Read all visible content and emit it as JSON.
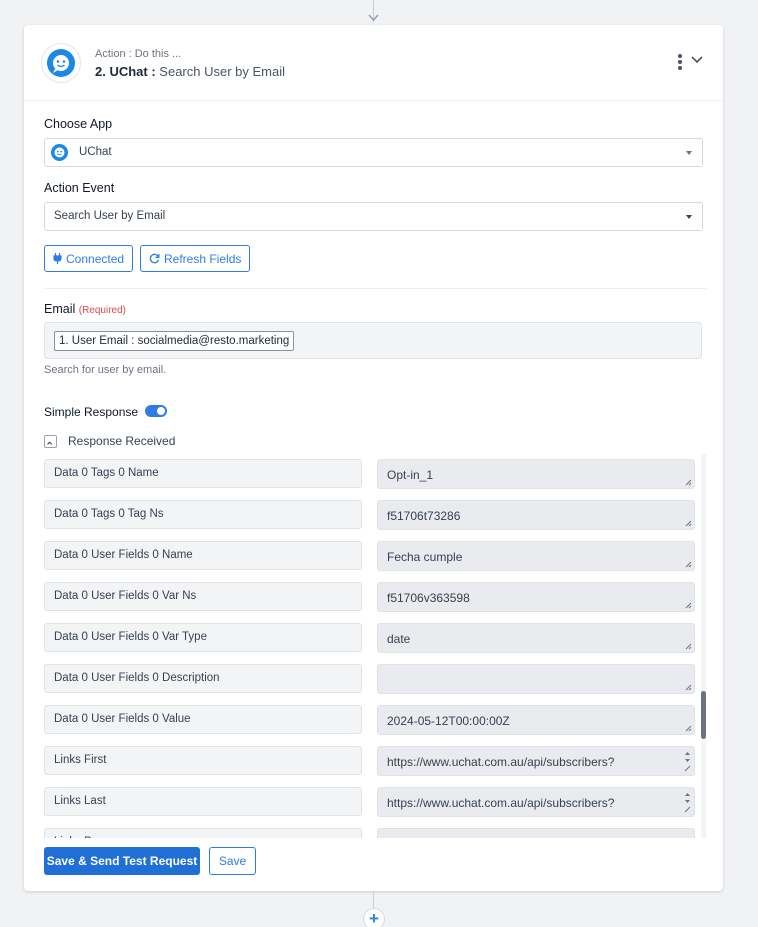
{
  "step": {
    "subtitle": "Action : Do this ...",
    "number_app": "2. UChat :",
    "event": "Search User by Email"
  },
  "form": {
    "choose_app_label": "Choose App",
    "app_value": "UChat",
    "action_event_label": "Action Event",
    "action_event_value": "Search User by Email",
    "connected_button": "Connected",
    "refresh_button": "Refresh Fields",
    "email_label": "Email",
    "required_tag": "(Required)",
    "email_chip": "1. User Email : socialmedia@resto.marketing",
    "email_hint": "Search for user by email.",
    "simple_response_label": "Simple Response",
    "simple_response_on": true,
    "response_received_label": "Response Received"
  },
  "response_rows": [
    {
      "key": "Data 0 Tags 0 Name",
      "value": "Opt-in_1"
    },
    {
      "key": "Data 0 Tags 0 Tag Ns",
      "value": "f51706t73286"
    },
    {
      "key": "Data 0 User Fields 0 Name",
      "value": "Fecha cumple"
    },
    {
      "key": "Data 0 User Fields 0 Var Ns",
      "value": "f51706v363598"
    },
    {
      "key": "Data 0 User Fields 0 Var Type",
      "value": "date"
    },
    {
      "key": "Data 0 User Fields 0 Description",
      "value": ""
    },
    {
      "key": "Data 0 User Fields 0 Value",
      "value": "2024-05-12T00:00:00Z"
    },
    {
      "key": "Links First",
      "value": "https://www.uchat.com.au/api/subscribers?"
    },
    {
      "key": "Links Last",
      "value": "https://www.uchat.com.au/api/subscribers?"
    },
    {
      "key": "Links Prev",
      "value": ""
    }
  ],
  "footer": {
    "save_send_button": "Save & Send Test Request",
    "save_button": "Save"
  },
  "colors": {
    "accent": "#2f7de1",
    "primary_button": "#1f6fd6",
    "app_brand": "#1e88e5",
    "required": "#e04848"
  }
}
